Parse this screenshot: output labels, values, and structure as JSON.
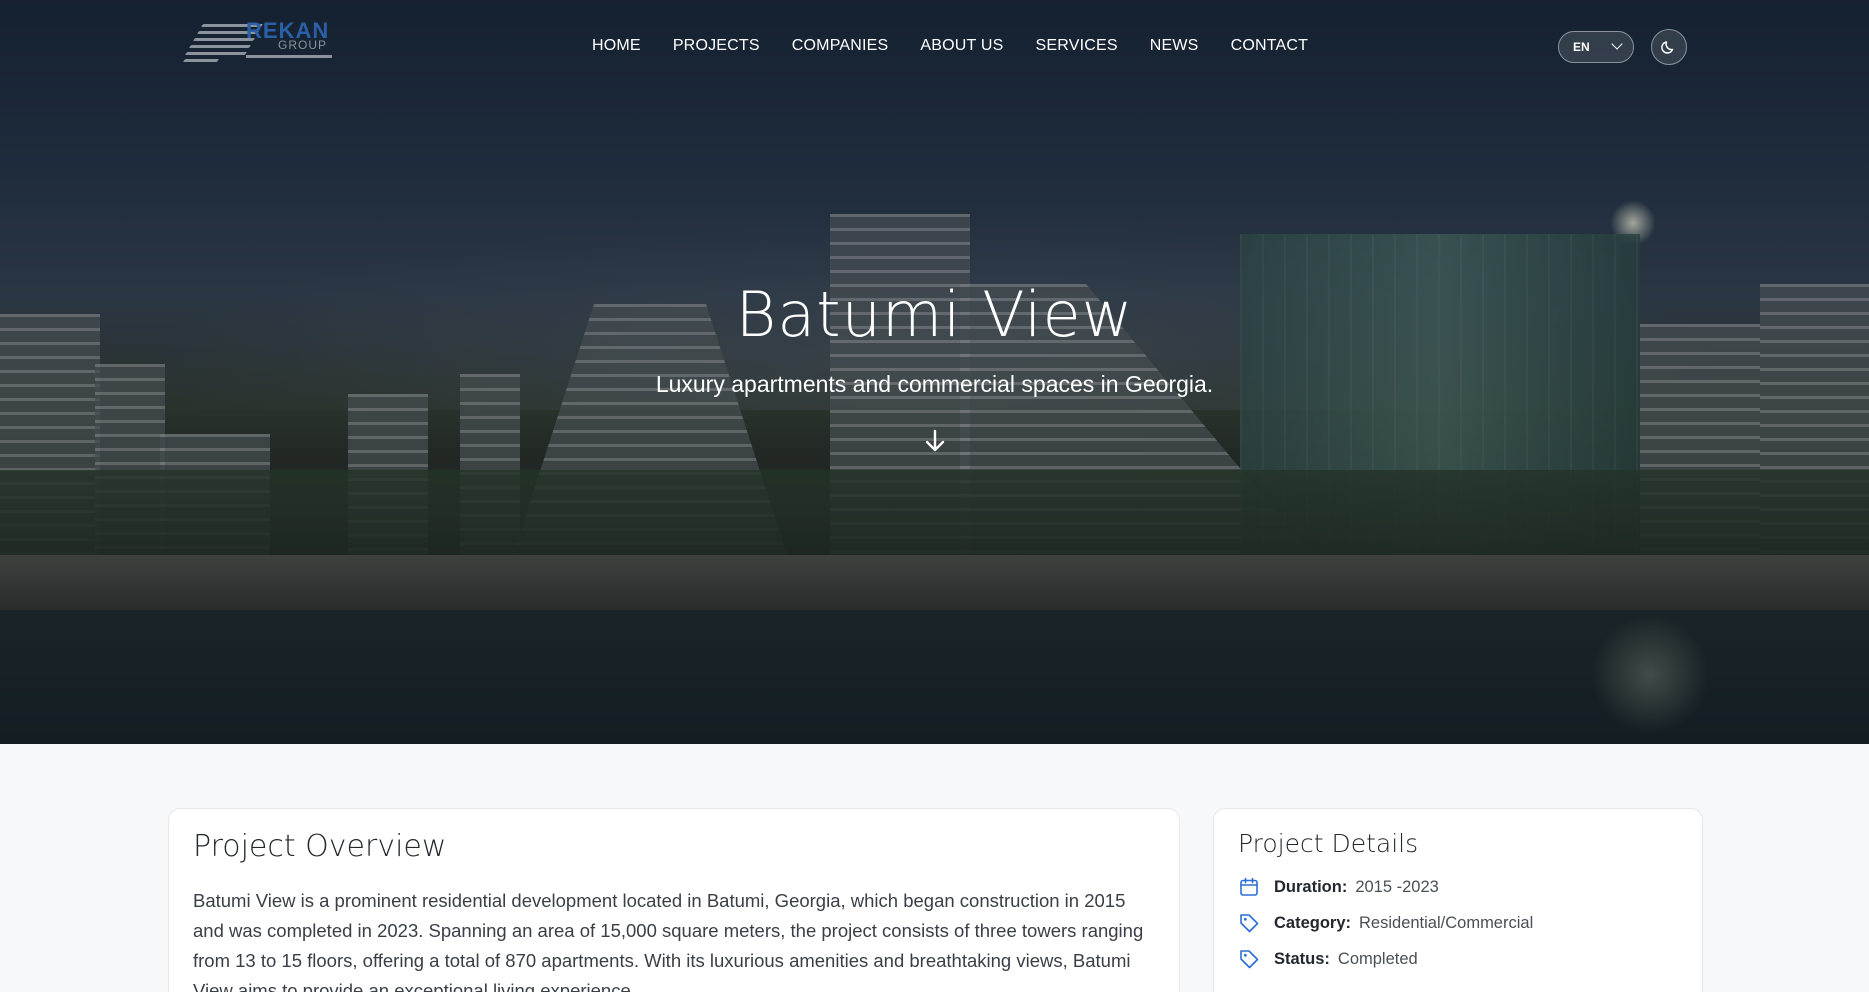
{
  "brand": {
    "name": "REKAN",
    "sub": "GROUP"
  },
  "nav": {
    "items": [
      {
        "label": "HOME"
      },
      {
        "label": "PROJECTS"
      },
      {
        "label": "COMPANIES"
      },
      {
        "label": "ABOUT US"
      },
      {
        "label": "SERVICES"
      },
      {
        "label": "NEWS"
      },
      {
        "label": "CONTACT"
      }
    ],
    "language": "EN",
    "theme_icon": "moon-icon"
  },
  "hero": {
    "title": "Batumi View",
    "subtitle": "Luxury apartments and commercial spaces in Georgia.",
    "scroll_icon": "arrow-down-icon"
  },
  "overview": {
    "heading": "Project Overview",
    "text": "Batumi View is a prominent residential development located in Batumi, Georgia, which began construction in 2015 and was completed in 2023. Spanning an area of 15,000 square meters, the project consists of three towers ranging from 13 to 15 floors, offering a total of 870 apartments. With its luxurious amenities and breathtaking views, Batumi View aims to provide an exceptional living experience."
  },
  "details": {
    "heading": "Project Details",
    "rows": [
      {
        "icon": "calendar-icon",
        "label": "Duration:",
        "value": "2015 -2023"
      },
      {
        "icon": "tag-icon",
        "label": "Category:",
        "value": "Residential/Commercial"
      },
      {
        "icon": "tag-icon",
        "label": "Status:",
        "value": "Completed"
      }
    ]
  },
  "colors": {
    "accent": "#2b6fd6",
    "brand_blue": "#2b5fa8",
    "page_bg": "#f7f8fa"
  }
}
